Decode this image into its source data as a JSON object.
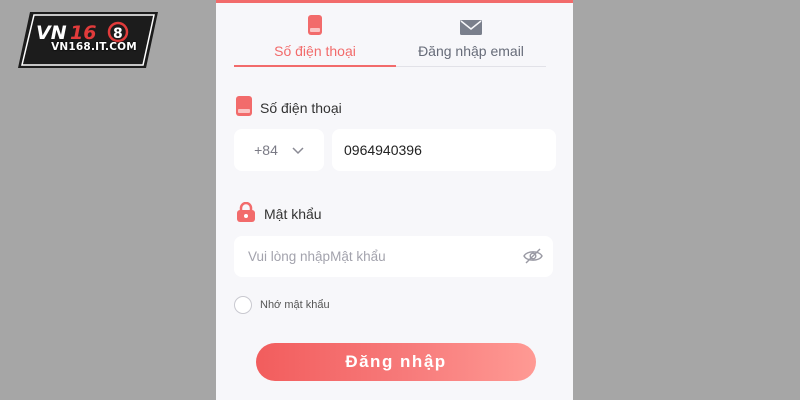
{
  "logo": {
    "brand": "VN168",
    "domain": "VN168.IT.COM",
    "icon": "vn168-logo"
  },
  "tabs": [
    {
      "label": "Số điện thoại",
      "icon": "phone-icon",
      "active": true
    },
    {
      "label": "Đăng nhập email",
      "icon": "mail-icon",
      "active": false
    }
  ],
  "phone_field": {
    "title": "Số điện thoại",
    "icon": "phone-icon",
    "country_code": "+84",
    "value": "0964940396"
  },
  "password_field": {
    "title": "Mật khẩu",
    "icon": "lock-icon",
    "placeholder": "Vui lòng nhậpMật khẩu",
    "value": "",
    "toggle_icon": "eye-off-icon"
  },
  "remember": {
    "label": "Nhớ mật khẩu",
    "checked": false
  },
  "login_button": {
    "label": "Đăng nhập"
  },
  "colors": {
    "accent": "#f26b6b",
    "background": "#a6a6a6",
    "panel": "#f7f7fa",
    "muted_text": "#666b78"
  }
}
